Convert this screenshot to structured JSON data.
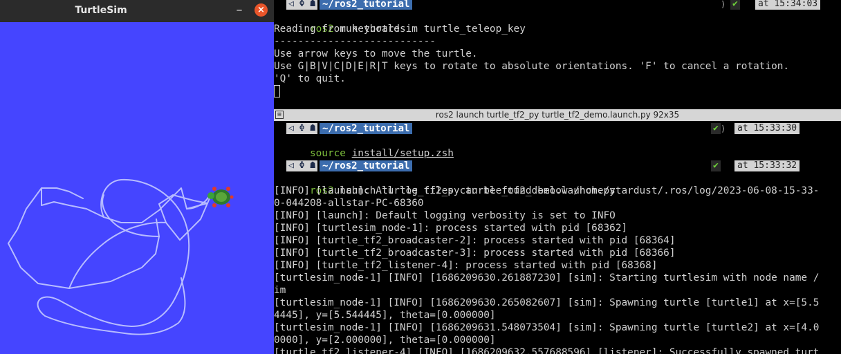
{
  "turtlesim": {
    "title": "TurtleSim",
    "minimize_glyph": "–",
    "close_glyph": "×",
    "background": "#4545ff",
    "trail_color": "#b7bcff",
    "turtle": "turtle-sprite"
  },
  "top_terminal": {
    "prompt_path": "~/ros2_tutorial",
    "prompt_icons": "◁ Φ ☗",
    "prompt_check": "✔",
    "prompt_time": "at 15:34:03",
    "command_word": "ros2",
    "command_rest": " run turtlesim turtle_teleop_key",
    "lines": [
      "Reading from keyboard",
      "---------------------------",
      "Use arrow keys to move the turtle.",
      "Use G|B|V|C|D|E|R|T keys to rotate to absolute orientations. 'F' to cancel a rotation.",
      "'Q' to quit."
    ]
  },
  "tab_bar": {
    "title": "ros2 launch turtle_tf2_py turtle_tf2_demo.launch.py 92x35"
  },
  "bottom_terminal": {
    "prompt1": {
      "path": "~/ros2_tutorial",
      "icons": "◁ Φ ☗",
      "check": "✔",
      "time": "at 15:33:30",
      "command_word": "source",
      "command_arg": "install/setup.zsh"
    },
    "prompt2": {
      "path": "~/ros2_tutorial",
      "icons": "◁ Φ ☗",
      "check": "✔",
      "time": "at 15:33:32",
      "command_word": "ros2",
      "command_rest": " launch turtle_tf2_py turtle_tf2_demo.launch.py"
    },
    "log_lines": [
      "[INFO] [launch]: All log files can be found below /home/stardust/.ros/log/2023-06-08-15-33-",
      "0-044208-allstar-PC-68360",
      "[INFO] [launch]: Default logging verbosity is set to INFO",
      "[INFO] [turtlesim_node-1]: process started with pid [68362]",
      "[INFO] [turtle_tf2_broadcaster-2]: process started with pid [68364]",
      "[INFO] [turtle_tf2_broadcaster-3]: process started with pid [68366]",
      "[INFO] [turtle_tf2_listener-4]: process started with pid [68368]",
      "[turtlesim_node-1] [INFO] [1686209630.261887230] [sim]: Starting turtlesim with node name /",
      "im",
      "[turtlesim_node-1] [INFO] [1686209630.265082607] [sim]: Spawning turtle [turtle1] at x=[5.5",
      "4445], y=[5.544445], theta=[0.000000]",
      "[turtlesim_node-1] [INFO] [1686209631.548073504] [sim]: Spawning turtle [turtle2] at x=[4.0",
      "0000], y=[2.000000], theta=[0.000000]",
      "[turtle_tf2_listener-4] [INFO] [1686209632.557688596] [listener]: Successfully spawned turt"
    ]
  }
}
